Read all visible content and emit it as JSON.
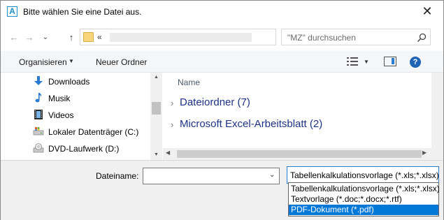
{
  "window": {
    "title": "Bitte wählen Sie eine Datei aus.",
    "app_icon_letter": "A",
    "close_glyph": "✕"
  },
  "address": {
    "back_glyph": "←",
    "forward_glyph": "→",
    "recent_glyph": "⌄",
    "up_glyph": "↑",
    "breadcrumb_prefix": "«",
    "dropdown_glyph": "⌄",
    "refresh_glyph": "↻"
  },
  "search": {
    "placeholder": "\"MZ\" durchsuchen"
  },
  "toolbar": {
    "organize_label": "Organisieren",
    "organize_arrow": "▼",
    "new_folder_label": "Neuer Ordner",
    "view_arrow": "▼",
    "help_glyph": "?"
  },
  "nav": {
    "items": [
      {
        "label": "Downloads",
        "icon": "download-icon"
      },
      {
        "label": "Musik",
        "icon": "music-icon"
      },
      {
        "label": "Videos",
        "icon": "video-icon"
      },
      {
        "label": "Lokaler Datenträger (C:)",
        "icon": "drive-icon"
      },
      {
        "label": "DVD-Laufwerk (D:)",
        "icon": "dvd-icon"
      }
    ],
    "scroll_up": "▲",
    "scroll_down": "▼"
  },
  "filelist": {
    "column_name": "Name",
    "groups": [
      {
        "label": "Dateiordner (7)"
      },
      {
        "label": "Microsoft Excel-Arbeitsblatt (2)"
      }
    ],
    "group_chevron": "›",
    "scroll_left": "◀",
    "scroll_right": "▶"
  },
  "bottom": {
    "filename_label": "Dateiname:",
    "filename_value": "",
    "filename_dropdown": "⌄",
    "filetype_selected": "Tabellenkalkulationsvorlage (*.xls;*.xlsx)",
    "filetype_options": [
      "Tabellenkalkulationsvorlage (*.xls;*.xlsx)",
      "Textvorlage (*.doc;*.docx;*.rtf)",
      "PDF-Dokument (*.pdf)"
    ],
    "filetype_highlighted_index": 2
  },
  "colors": {
    "accent": "#0078d7",
    "group_text": "#1e3287",
    "app_icon": "#1f8ec9"
  }
}
